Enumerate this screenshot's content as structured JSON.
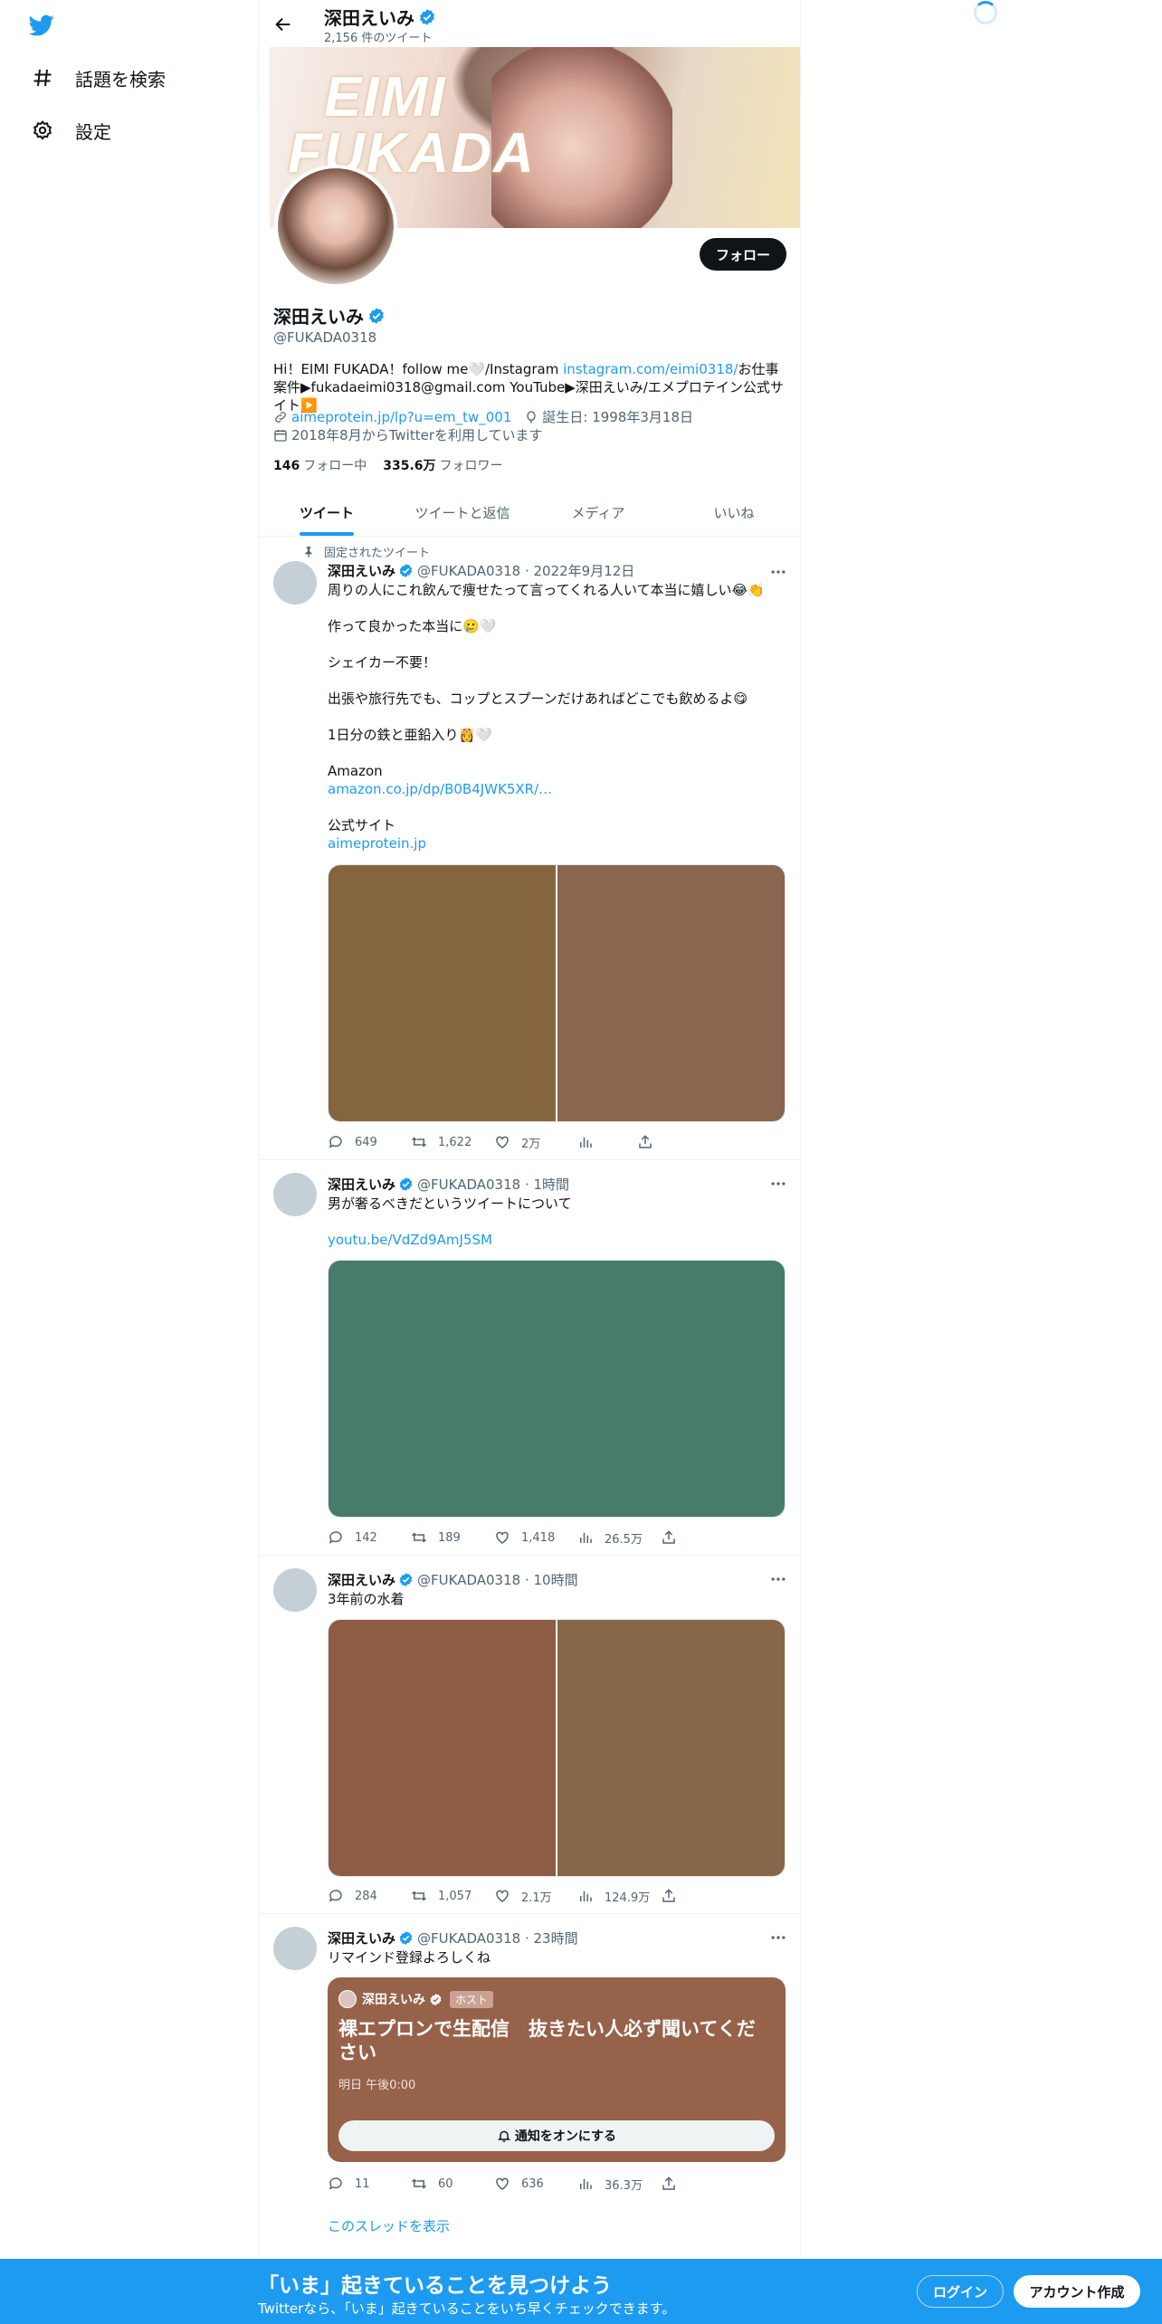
{
  "nav": {
    "items": [
      {
        "label": "話題を検索",
        "icon": "hashtag-icon"
      },
      {
        "label": "設定",
        "icon": "gear-icon"
      }
    ]
  },
  "header": {
    "name": "深田えいみ",
    "tweet_count": "2,156 件のツイート"
  },
  "banner": {
    "text_line1": "EIMI",
    "text_line2": "FUKADA"
  },
  "profile": {
    "follow_label": "フォロー",
    "name": "深田えいみ",
    "handle": "@FUKADA0318",
    "bio_part1": "Hi！EIMI FUKADA！follow me🤍/Instagram ",
    "bio_link": "instagram.com/eimi0318/",
    "bio_part2": "お仕事案件▶fukadaeimi0318@gmail.com YouTube▶深田えいみ/エメプロテイン公式サイト▶️",
    "website": "aimeprotein.jp/lp?u=em_tw_001",
    "birthday": "誕生日: 1998年3月18日",
    "joined": "2018年8月からTwitterを利用しています",
    "following_count": "146",
    "following_label": "フォロー中",
    "followers_count": "335.6万",
    "followers_label": "フォロワー"
  },
  "tabs": [
    {
      "label": "ツイート",
      "active": true
    },
    {
      "label": "ツイートと返信",
      "active": false
    },
    {
      "label": "メディア",
      "active": false
    },
    {
      "label": "いいね",
      "active": false
    }
  ],
  "tweets": [
    {
      "pinned_label": "固定されたツイート",
      "name": "深田えいみ",
      "handle_time": "@FUKADA0318 · 2022年9月12日",
      "lines": [
        "周りの人にこれ飲んで痩せたって言ってくれる人いて本当に嬉しい😂👏",
        "",
        "作って良かった本当に🥲🤍",
        "",
        "シェイカー不要！",
        "",
        "出張や旅行先でも、コップとスプーンだけあればどこでも飲めるよ😋",
        "",
        "1日分の鉄と亜鉛入り👸🤍",
        "",
        "Amazon"
      ],
      "link1": "amazon.co.jp/dp/B0B4JWK5XR/…",
      "line_after": "公式サイト",
      "link2": "aimeprotein.jp",
      "media_colors": [
        "#85653f",
        "#8a654f"
      ],
      "replies": "649",
      "retweets": "1,622",
      "likes": "2万",
      "views": ""
    },
    {
      "name": "深田えいみ",
      "handle_time": "@FUKADA0318 · 1時間",
      "text": "男が奢るべきだというツイートについて",
      "link": "youtu.be/VdZd9AmJ5SM",
      "media_colors": [
        "#477b6c"
      ],
      "replies": "142",
      "retweets": "189",
      "likes": "1,418",
      "views": "26.5万"
    },
    {
      "name": "深田えいみ",
      "handle_time": "@FUKADA0318 · 10時間",
      "text": "3年前の水着",
      "media_colors": [
        "#8d5c44",
        "#87664a"
      ],
      "replies": "284",
      "retweets": "1,057",
      "likes": "2.1万",
      "views": "124.9万"
    },
    {
      "name": "深田えいみ",
      "handle_time": "@FUKADA0318 · 23時間",
      "text": "リマインド登録よろしくね",
      "space": {
        "host_name": "深田えいみ",
        "host_badge": "ホスト",
        "title": "裸エプロンで生配信　抜きたい人必ず聞いてください",
        "time": "明日 午後0:00",
        "button": "通知をオンにする"
      },
      "replies": "11",
      "retweets": "60",
      "likes": "636",
      "views": "36.3万",
      "thread_link": "このスレッドを表示"
    }
  ],
  "bottom_bar": {
    "title": "「いま」起きていることを見つけよう",
    "subtitle": "Twitterなら、「いま」起きていることをいち早くチェックできます。",
    "login": "ログイン",
    "signup": "アカウント作成"
  },
  "colors": {
    "accent": "#1d9bf0",
    "text": "#0f1419",
    "secondary": "#536471"
  }
}
